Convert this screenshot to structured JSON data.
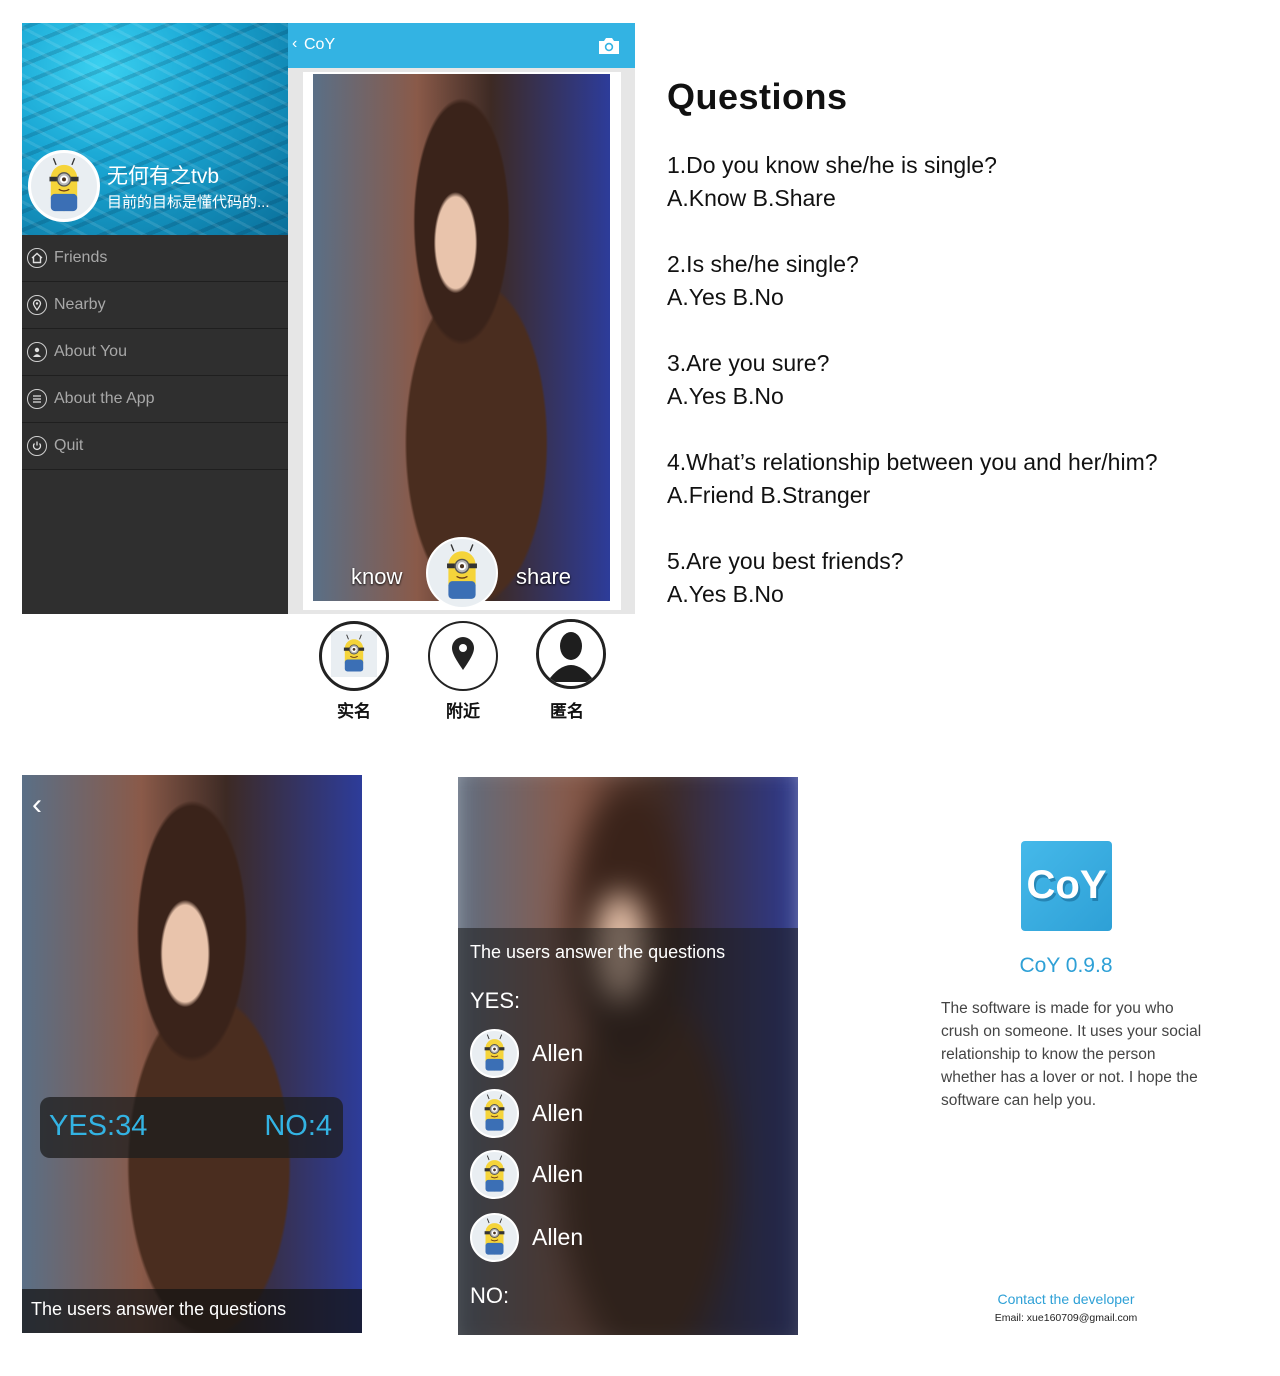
{
  "menu": {
    "username": "无何有之tvb",
    "tagline": "目前的目标是懂代码的...",
    "items": [
      {
        "label": "Friends",
        "icon": "home-icon"
      },
      {
        "label": "Nearby",
        "icon": "location-pin-icon"
      },
      {
        "label": "About You",
        "icon": "user-icon"
      },
      {
        "label": "About the App",
        "icon": "list-icon"
      },
      {
        "label": "Quit",
        "icon": "power-icon"
      }
    ]
  },
  "main": {
    "back_glyph": "‹",
    "title": "CoY",
    "camera_icon": "camera-icon",
    "know_label": "know",
    "share_label": "share",
    "accent": "#33b3e3"
  },
  "tabs": [
    {
      "label": "实名",
      "icon": "minion-avatar-icon"
    },
    {
      "label": "附近",
      "icon": "location-pin-icon"
    },
    {
      "label": "匿名",
      "icon": "anonymous-user-icon"
    }
  ],
  "questions": {
    "title": "Questions",
    "items": [
      {
        "q": "1.Do you know she/he is single?",
        "a": "A.Know B.Share"
      },
      {
        "q": "2.Is she/he single?",
        "a": "A.Yes B.No"
      },
      {
        "q": "3.Are you sure?",
        "a": "A.Yes B.No"
      },
      {
        "q": "4.What’s relationship between you and her/him?",
        "a": "A.Friend B.Stranger"
      },
      {
        "q": "5.Are you best friends?",
        "a": "A.Yes B.No"
      }
    ]
  },
  "result": {
    "back_glyph": "‹",
    "yes_label": "YES:34",
    "no_label": "NO:4",
    "footer": "The users answer the questions"
  },
  "answers": {
    "heading": "The users answer the questions",
    "yes_label": "YES:",
    "users": [
      "Allen",
      "Allen",
      "Allen",
      "Allen"
    ],
    "no_label": "NO:"
  },
  "about": {
    "logo_text": "CoY",
    "version": "CoY 0.9.8",
    "description": "The software is made for you who crush on someone. It uses your social relationship to know the person whether has a lover or not. I hope the software can help you.",
    "contact": "Contact the developer",
    "email": "Email: xue160709@gmail.com"
  }
}
